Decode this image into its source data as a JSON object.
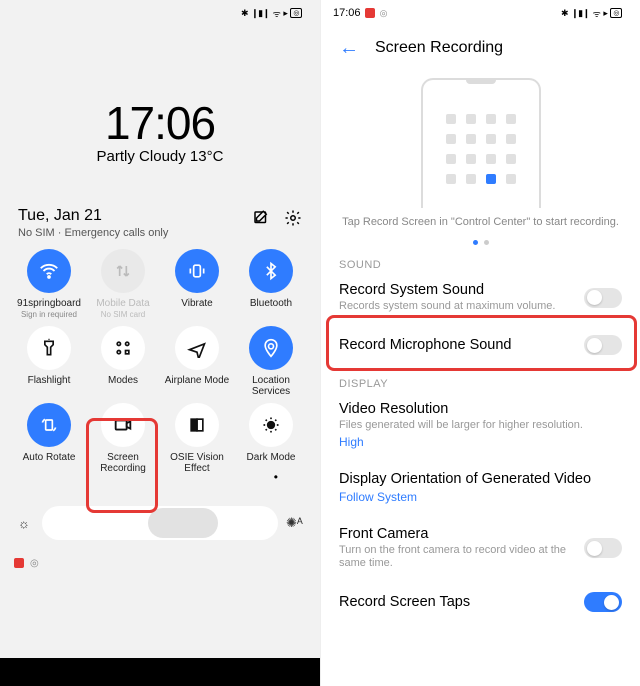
{
  "status": {
    "time": "17:06",
    "icons_text": "✻ ⌀ ⏻ ᯤ ▣ ⬚"
  },
  "lock": {
    "time": "17:06",
    "weather": "Partly Cloudy 13°C",
    "date": "Tue, Jan 21",
    "sim": "No SIM · Emergency calls only"
  },
  "qs": [
    {
      "label": "91springboard",
      "sub": "Sign in required",
      "state": "on",
      "icon": "wifi"
    },
    {
      "label": "Mobile Data",
      "sub": "No SIM card",
      "state": "disabled",
      "icon": "data"
    },
    {
      "label": "Vibrate",
      "sub": "",
      "state": "on",
      "icon": "vibrate"
    },
    {
      "label": "Bluetooth",
      "sub": "",
      "state": "on",
      "icon": "bluetooth"
    },
    {
      "label": "Flashlight",
      "sub": "",
      "state": "off",
      "icon": "flashlight"
    },
    {
      "label": "Modes",
      "sub": "",
      "state": "off",
      "icon": "modes"
    },
    {
      "label": "Airplane Mode",
      "sub": "",
      "state": "off",
      "icon": "airplane"
    },
    {
      "label": "Location Services",
      "sub": "",
      "state": "on",
      "icon": "location"
    },
    {
      "label": "Auto Rotate",
      "sub": "",
      "state": "on",
      "icon": "rotate"
    },
    {
      "label": "Screen Recording",
      "sub": "",
      "state": "off",
      "icon": "record"
    },
    {
      "label": "OSIE Vision Effect",
      "sub": "",
      "state": "off",
      "icon": "osie"
    },
    {
      "label": "Dark Mode",
      "sub": "",
      "state": "off",
      "icon": "dark"
    }
  ],
  "right": {
    "title": "Screen Recording",
    "hint": "Tap Record Screen in \"Control Center\" to start recording.",
    "section_sound": "SOUND",
    "section_display": "DISPLAY",
    "rows": {
      "sys_sound": {
        "title": "Record System Sound",
        "desc": "Records system sound at maximum volume.",
        "toggle": "off"
      },
      "mic_sound": {
        "title": "Record Microphone Sound",
        "desc": "",
        "toggle": "off"
      },
      "video_res": {
        "title": "Video Resolution",
        "desc": "Files generated will be larger for higher resolution.",
        "link": "High"
      },
      "orient": {
        "title": "Display Orientation of Generated Video",
        "link": "Follow System"
      },
      "front_cam": {
        "title": "Front Camera",
        "desc": "Turn on the front camera to record video at the same time.",
        "toggle": "off"
      },
      "taps": {
        "title": "Record Screen Taps",
        "toggle": "on"
      }
    }
  }
}
